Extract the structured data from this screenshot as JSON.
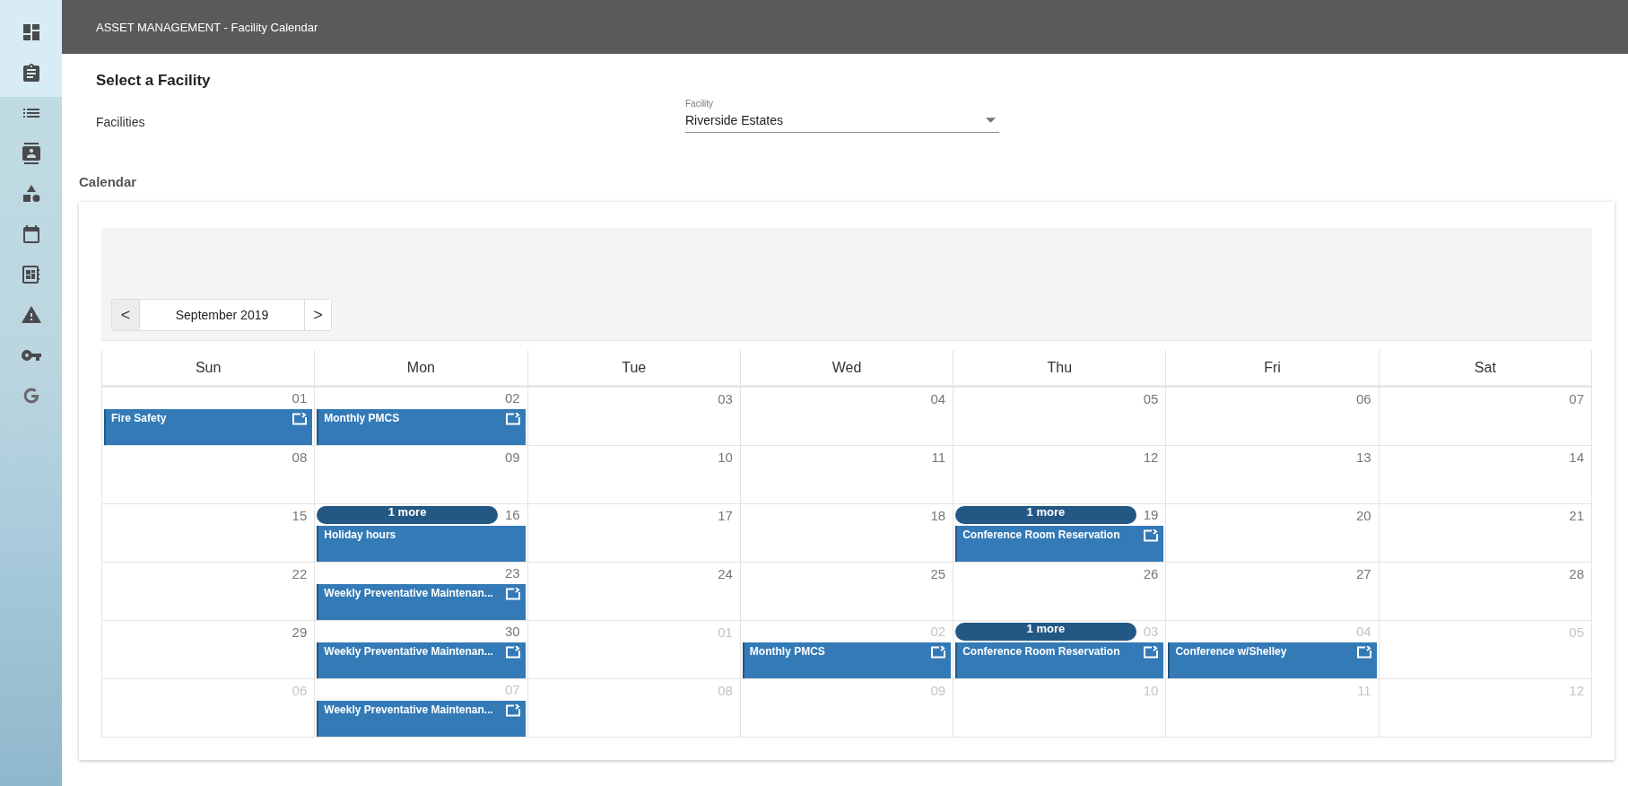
{
  "sidebar": {
    "items": [
      {
        "kind": "dashboard"
      },
      {
        "kind": "clipboard"
      },
      {
        "kind": "list"
      },
      {
        "kind": "contacts"
      },
      {
        "kind": "shapes"
      },
      {
        "kind": "calendar"
      },
      {
        "kind": "board"
      },
      {
        "kind": "warning"
      },
      {
        "kind": "key"
      },
      {
        "kind": "g"
      }
    ]
  },
  "header": {
    "title": "ASSET MANAGEMENT - Facility Calendar"
  },
  "facility_section": {
    "title": "Select a Facility",
    "label": "Facilities",
    "field": {
      "label": "Facility",
      "value": "Riverside Estates"
    }
  },
  "calendar": {
    "title": "Calendar",
    "nav": {
      "prev": "<",
      "month": "September 2019",
      "next": ">"
    },
    "weekdays": [
      "Sun",
      "Mon",
      "Tue",
      "Wed",
      "Thu",
      "Fri",
      "Sat"
    ],
    "weeks": [
      [
        {
          "day": "01",
          "other_month": false,
          "events": [
            {
              "title": "Fire Safety",
              "recurring": true
            }
          ]
        },
        {
          "day": "02",
          "other_month": false,
          "events": [
            {
              "title": "Monthly PMCS",
              "recurring": true
            }
          ]
        },
        {
          "day": "03",
          "other_month": false
        },
        {
          "day": "04",
          "other_month": false
        },
        {
          "day": "05",
          "other_month": false
        },
        {
          "day": "06",
          "other_month": false
        },
        {
          "day": "07",
          "other_month": false
        }
      ],
      [
        {
          "day": "08",
          "other_month": false
        },
        {
          "day": "09",
          "other_month": false
        },
        {
          "day": "10",
          "other_month": false
        },
        {
          "day": "11",
          "other_month": false
        },
        {
          "day": "12",
          "other_month": false
        },
        {
          "day": "13",
          "other_month": false
        },
        {
          "day": "14",
          "other_month": false
        }
      ],
      [
        {
          "day": "15",
          "other_month": false
        },
        {
          "day": "16",
          "other_month": false,
          "more": "1 more",
          "events": [
            {
              "title": "Holiday hours",
              "recurring": false
            }
          ]
        },
        {
          "day": "17",
          "other_month": false
        },
        {
          "day": "18",
          "other_month": false
        },
        {
          "day": "19",
          "other_month": false,
          "more": "1 more",
          "events": [
            {
              "title": "Conference Room Reservation",
              "recurring": true
            }
          ]
        },
        {
          "day": "20",
          "other_month": false
        },
        {
          "day": "21",
          "other_month": false
        }
      ],
      [
        {
          "day": "22",
          "other_month": false
        },
        {
          "day": "23",
          "other_month": false,
          "events": [
            {
              "title": "Weekly Preventative Maintenan...",
              "recurring": true
            }
          ]
        },
        {
          "day": "24",
          "other_month": false
        },
        {
          "day": "25",
          "other_month": false
        },
        {
          "day": "26",
          "other_month": false
        },
        {
          "day": "27",
          "other_month": false
        },
        {
          "day": "28",
          "other_month": false
        }
      ],
      [
        {
          "day": "29",
          "other_month": false
        },
        {
          "day": "30",
          "other_month": false,
          "events": [
            {
              "title": "Weekly Preventative Maintenan...",
              "recurring": true
            }
          ]
        },
        {
          "day": "01",
          "other_month": true
        },
        {
          "day": "02",
          "other_month": true,
          "events": [
            {
              "title": "Monthly PMCS",
              "recurring": true
            }
          ]
        },
        {
          "day": "03",
          "other_month": true,
          "more": "1 more",
          "events": [
            {
              "title": "Conference Room Reservation",
              "recurring": true
            }
          ]
        },
        {
          "day": "04",
          "other_month": true,
          "events": [
            {
              "title": "Conference w/Shelley",
              "recurring": true
            }
          ]
        },
        {
          "day": "05",
          "other_month": true
        }
      ],
      [
        {
          "day": "06",
          "other_month": true
        },
        {
          "day": "07",
          "other_month": true,
          "events": [
            {
              "title": "Weekly Preventative Maintenan...",
              "recurring": true
            }
          ]
        },
        {
          "day": "08",
          "other_month": true
        },
        {
          "day": "09",
          "other_month": true
        },
        {
          "day": "10",
          "other_month": true
        },
        {
          "day": "11",
          "other_month": true
        },
        {
          "day": "12",
          "other_month": true
        }
      ]
    ]
  }
}
